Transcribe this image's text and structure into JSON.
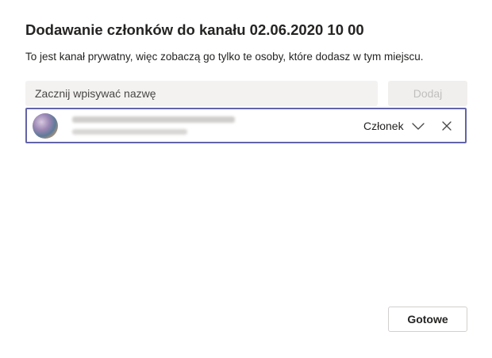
{
  "dialog": {
    "title": "Dodawanie członków do kanału 02.06.2020 10 00",
    "subtitle": "To jest kanał prywatny, więc zobaczą go tylko te osoby, które dodasz w tym miejscu."
  },
  "search": {
    "placeholder": "Zacznij wpisywać nazwę",
    "add_label": "Dodaj"
  },
  "member": {
    "name_blurred": true,
    "role": "Członek",
    "icons": {
      "role_dropdown": "chevron-down-icon",
      "remove": "close-icon"
    }
  },
  "footer": {
    "done_label": "Gotowe"
  },
  "colors": {
    "accent": "#6264a7",
    "input_bg": "#f3f2f1",
    "disabled_button_bg": "#f0efee",
    "disabled_text": "#c1bfbd",
    "text": "#252423"
  }
}
